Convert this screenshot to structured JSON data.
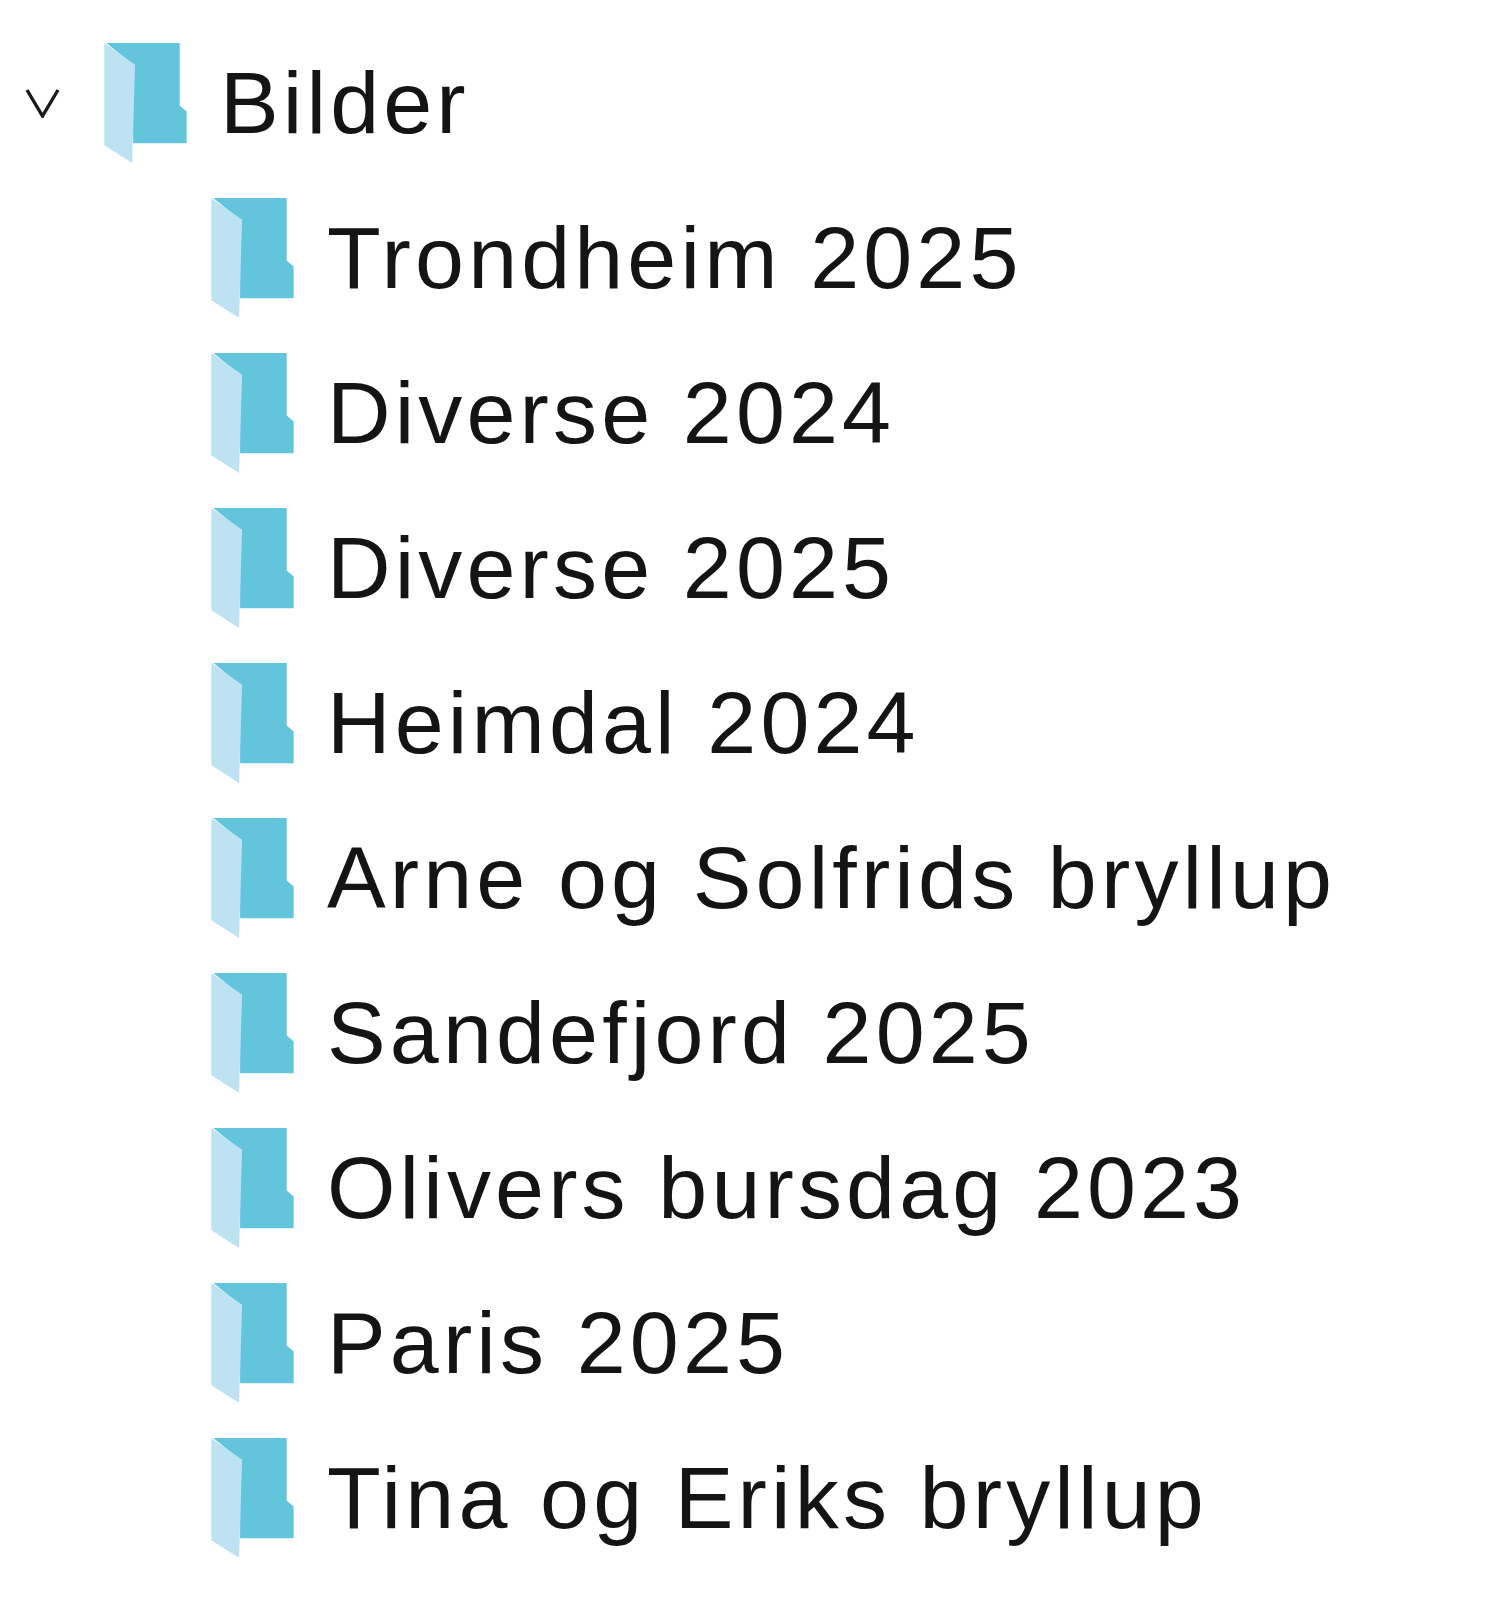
{
  "tree": [
    {
      "label": "Bilder",
      "expanded": true,
      "children": [
        {
          "label": "Trondheim 2025"
        },
        {
          "label": "Diverse 2024"
        },
        {
          "label": "Diverse 2025"
        },
        {
          "label": "Heimdal 2024"
        },
        {
          "label": "Arne og Solfrids bryllup"
        },
        {
          "label": "Sandefjord 2025"
        },
        {
          "label": "Olivers bursdag 2023"
        },
        {
          "label": "Paris 2025"
        },
        {
          "label": "Tina og Eriks bryllup"
        }
      ]
    }
  ]
}
